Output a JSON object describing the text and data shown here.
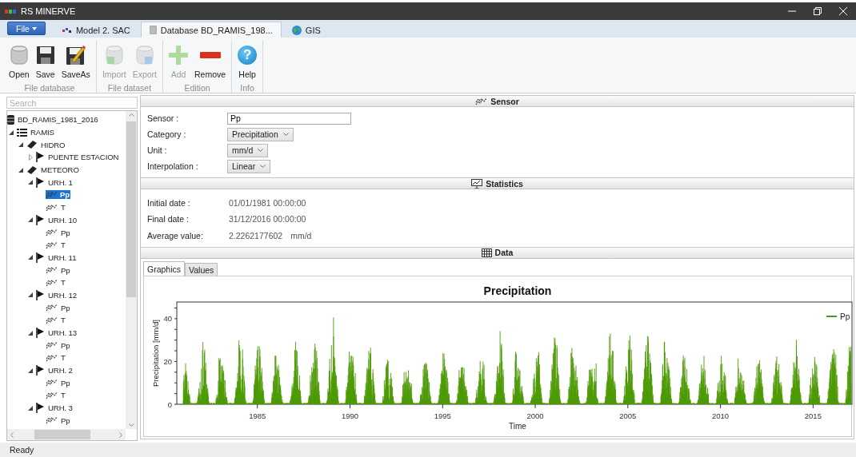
{
  "window": {
    "title": "RS MINERVE"
  },
  "file_menu": {
    "label": "File"
  },
  "document_tabs": [
    {
      "label": "Model 2. SAC",
      "kind": "model",
      "selected": false
    },
    {
      "label": "Database BD_RAMIS_198...",
      "kind": "database",
      "selected": true
    },
    {
      "label": "GIS",
      "kind": "globe",
      "selected": false
    }
  ],
  "ribbon": [
    {
      "label": "File database",
      "buttons": [
        {
          "label": "Open",
          "kind": "open",
          "disabled": false
        },
        {
          "label": "Save",
          "kind": "save",
          "disabled": false
        },
        {
          "label": "SaveAs",
          "kind": "saveas",
          "disabled": false
        }
      ]
    },
    {
      "label": "File dataset",
      "buttons": [
        {
          "label": "Import",
          "kind": "import",
          "disabled": true
        },
        {
          "label": "Export",
          "kind": "export",
          "disabled": true
        }
      ]
    },
    {
      "label": "Edition",
      "buttons": [
        {
          "label": "Add",
          "kind": "add",
          "disabled": true
        },
        {
          "label": "Remove",
          "kind": "remove",
          "disabled": false
        }
      ]
    },
    {
      "label": "Info",
      "buttons": [
        {
          "label": "Help",
          "kind": "help",
          "glyph": "?",
          "disabled": false
        }
      ]
    }
  ],
  "search": {
    "placeholder": "Search"
  },
  "tree": [
    {
      "label": "BD_RAMIS_1981_2016",
      "kind": "database",
      "selected": false
    },
    {
      "label": "RAMIS",
      "kind": "model",
      "selected": false,
      "expanded": true,
      "children": [
        {
          "label": "HIDRO",
          "kind": "group",
          "selected": false,
          "expanded": true,
          "children": [
            {
              "label": "PUENTE  ESTACION",
              "kind": "station",
              "selected": false,
              "expanded": false
            }
          ]
        },
        {
          "label": "METEORO",
          "kind": "group",
          "selected": false,
          "expanded": true,
          "children": [
            {
              "label": "URH. 1",
              "kind": "station",
              "selected": false,
              "expanded": true,
              "children": [
                {
                  "label": "Pp",
                  "kind": "sensor",
                  "selected": true
                },
                {
                  "label": "T",
                  "kind": "sensor",
                  "selected": false
                }
              ]
            },
            {
              "label": "URH. 10",
              "kind": "station",
              "selected": false,
              "expanded": true,
              "children": [
                {
                  "label": "Pp",
                  "kind": "sensor",
                  "selected": false
                },
                {
                  "label": "T",
                  "kind": "sensor",
                  "selected": false
                }
              ]
            },
            {
              "label": "URH. 11",
              "kind": "station",
              "selected": false,
              "expanded": true,
              "children": [
                {
                  "label": "Pp",
                  "kind": "sensor",
                  "selected": false
                },
                {
                  "label": "T",
                  "kind": "sensor",
                  "selected": false
                }
              ]
            },
            {
              "label": "URH. 12",
              "kind": "station",
              "selected": false,
              "expanded": true,
              "children": [
                {
                  "label": "Pp",
                  "kind": "sensor",
                  "selected": false
                },
                {
                  "label": "T",
                  "kind": "sensor",
                  "selected": false
                }
              ]
            },
            {
              "label": "URH. 13",
              "kind": "station",
              "selected": false,
              "expanded": true,
              "children": [
                {
                  "label": "Pp",
                  "kind": "sensor",
                  "selected": false
                },
                {
                  "label": "T",
                  "kind": "sensor",
                  "selected": false
                }
              ]
            },
            {
              "label": "URH. 2",
              "kind": "station",
              "selected": false,
              "expanded": true,
              "children": [
                {
                  "label": "Pp",
                  "kind": "sensor",
                  "selected": false
                },
                {
                  "label": "T",
                  "kind": "sensor",
                  "selected": false
                }
              ]
            },
            {
              "label": "URH. 3",
              "kind": "station",
              "selected": false,
              "expanded": true,
              "children": [
                {
                  "label": "Pp",
                  "kind": "sensor",
                  "selected": false
                }
              ]
            }
          ]
        }
      ]
    }
  ],
  "sensor_section": {
    "title": "Sensor",
    "fields": [
      {
        "label": "Sensor :",
        "kind": "text",
        "value": "Pp"
      },
      {
        "label": "Category :",
        "kind": "dropdown",
        "value": "Precipitation"
      },
      {
        "label": "Unit :",
        "kind": "dropdown",
        "value": "mm/d"
      },
      {
        "label": "Interpolation :",
        "kind": "dropdown",
        "value": "Linear"
      }
    ]
  },
  "statistics_section": {
    "title": "Statistics",
    "rows": [
      {
        "label": "Initial date :",
        "value": "01/01/1981 00:00:00"
      },
      {
        "label": "Final date :",
        "value": "31/12/2016 00:00:00"
      },
      {
        "label": "Average value:",
        "value": "2.2262177602",
        "unit": "mm/d"
      }
    ]
  },
  "data_section": {
    "title": "Data",
    "tabs": [
      {
        "label": "Graphics",
        "selected": true
      },
      {
        "label": "Values",
        "selected": false
      }
    ],
    "chart": {
      "title": "Precipitation",
      "xlabel": "Time",
      "ylabel": "Precipitation [mm/d]",
      "legend": "Pp",
      "x_tick_labels": [
        "1985",
        "1990",
        "1995",
        "2000",
        "2005",
        "2010",
        "2015"
      ],
      "y_tick_labels": [
        "40",
        "20",
        "0"
      ]
    }
  },
  "status_bar": {
    "text": "Ready"
  }
}
